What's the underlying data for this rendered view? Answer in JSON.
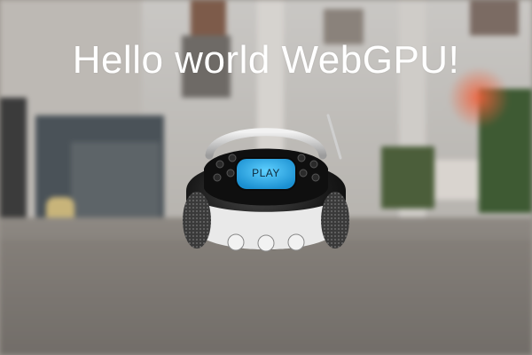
{
  "canvas": {
    "title": "Hello world WebGPU!"
  },
  "model": {
    "play_label": "PLAY",
    "screen_color": "#2bb0ea",
    "body_color": "#151515",
    "trim_color": "#e9e9e9"
  }
}
